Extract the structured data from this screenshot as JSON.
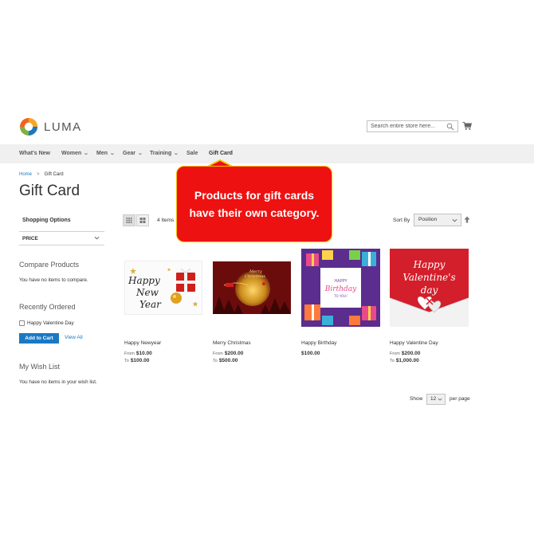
{
  "header": {
    "logo_text": "LUMA",
    "search_placeholder": "Search entire store here...",
    "icons": {
      "search": "search-icon",
      "cart": "cart-icon"
    }
  },
  "nav": {
    "items": [
      {
        "label": "What's New",
        "has_dropdown": false
      },
      {
        "label": "Women",
        "has_dropdown": true
      },
      {
        "label": "Men",
        "has_dropdown": true
      },
      {
        "label": "Gear",
        "has_dropdown": true
      },
      {
        "label": "Training",
        "has_dropdown": true
      },
      {
        "label": "Sale",
        "has_dropdown": false
      },
      {
        "label": "Gift Card",
        "has_dropdown": false
      }
    ]
  },
  "breadcrumb": {
    "home": "Home",
    "separator": ">",
    "current": "Gift Card"
  },
  "page_title": "Gift Card",
  "sidebar": {
    "shopping_options": "Shopping Options",
    "filter_price": "PRICE",
    "compare_title": "Compare Products",
    "compare_text": "You have no items to compare.",
    "recent_title": "Recently Ordered",
    "recent_item": "Happy Valentine Day",
    "add_to_cart": "Add to Cart",
    "view_all": "View All",
    "wishlist_title": "My Wish List",
    "wishlist_text": "You have no items in your wish list."
  },
  "toolbar": {
    "amount": "4 Items",
    "sort_by_label": "Sort By",
    "sort_value": "Position",
    "show_label": "Show",
    "limit_value": "12",
    "per_page": "per page"
  },
  "products": [
    {
      "name": "Happy Newyear",
      "from_label": "From",
      "from": "$10.00",
      "to_label": "To",
      "to": "$100.00"
    },
    {
      "name": "Merry Christmas",
      "from_label": "From",
      "from": "$200.00",
      "to_label": "To",
      "to": "$500.00"
    },
    {
      "name": "Happy Birthday",
      "price": "$100.00"
    },
    {
      "name": "Happy Valentine Day",
      "from_label": "From",
      "from": "$200.00",
      "to_label": "To",
      "to": "$1,000.00"
    }
  ],
  "product_image_text": {
    "newyear": [
      "Happy",
      "New",
      "Year"
    ],
    "christmas": [
      "Merry",
      "Christmas"
    ],
    "birthday": [
      "HAPPY",
      "Birthday",
      "TO YOU!"
    ],
    "valentine": [
      "Happy",
      "Valentine's",
      "day"
    ]
  },
  "callout": {
    "line1": "Products for gift cards",
    "line2": "have their own category."
  },
  "colors": {
    "link": "#1979c3",
    "nav_bg": "#f0f0f0",
    "callout_bg": "#ee1111",
    "callout_border": "#f2c200"
  }
}
